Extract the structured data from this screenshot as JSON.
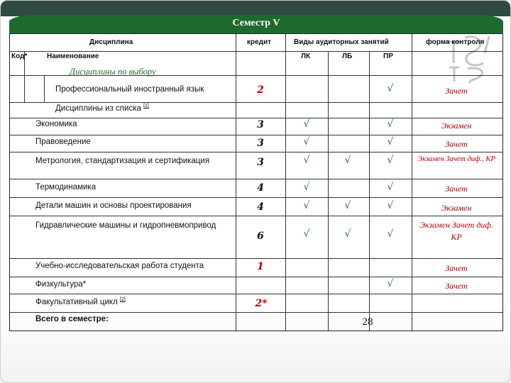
{
  "title": "Семестр V",
  "header": {
    "discipline": "Дисциплина",
    "credit": "кредит",
    "activity_types": "Виды аудиторных занятий",
    "control_form": "форма контроля",
    "code": "Код*",
    "name": "Наименование",
    "lk": "ЛК",
    "lb": "ЛБ",
    "pr": "ПР"
  },
  "groups": {
    "elective": "Дисциплины по выбору",
    "from_list": "Дисциплины из списка",
    "from_list_ref": "[1]"
  },
  "rows": [
    {
      "name": "Профессиональный иностранный язык",
      "credit": "2",
      "lk": "",
      "lb": "",
      "pr": "√",
      "control": "Зачет"
    },
    {
      "name": "Экономика",
      "credit": "3",
      "lk": "√",
      "lb": "",
      "pr": "√",
      "control": "Экзамен"
    },
    {
      "name": "Правоведение",
      "credit": "3",
      "lk": "√",
      "lb": "",
      "pr": "√",
      "control": "Зачет"
    },
    {
      "name": "Метрология, стандартизация и сертификация",
      "credit": "3",
      "lk": "√",
      "lb": "√",
      "pr": "√",
      "control": "Экзамен Зачет диф., КР"
    },
    {
      "name": "Термодинамика",
      "credit": "4",
      "lk": "√",
      "lb": "",
      "pr": "√",
      "control": "Зачет"
    },
    {
      "name": "Детали машин и основы проектирования",
      "credit": "4",
      "lk": "√",
      "lb": "√",
      "pr": "√",
      "control": "Экзамен"
    },
    {
      "name": "Гидравлические машины и гидропневмопривод",
      "credit": "6",
      "lk": "√",
      "lb": "√",
      "pr": "√",
      "control": "Экзамен Зачет диф. КР"
    },
    {
      "name": "Учебно-исследовательская работа студента",
      "credit": "1",
      "lk": "",
      "lb": "",
      "pr": "",
      "control": "Зачет"
    },
    {
      "name": "Физкультура*",
      "credit": "",
      "lk": "",
      "lb": "",
      "pr": "√",
      "control": "Зачет"
    },
    {
      "name": "Факультативный цикл",
      "name_ref": "[2]",
      "credit": "2*",
      "lk": "",
      "lb": "",
      "pr": "",
      "control": ""
    }
  ],
  "total": {
    "label": "Всего в семестре:",
    "value": "28"
  },
  "colors": {
    "title_bar": "#1e6a2e",
    "top_band": "#2f4a42",
    "credit_text": "#111111",
    "control_text": "#b00000",
    "check": "#1a7a2a"
  },
  "icons": {
    "logo": "university-monogram-logo"
  }
}
